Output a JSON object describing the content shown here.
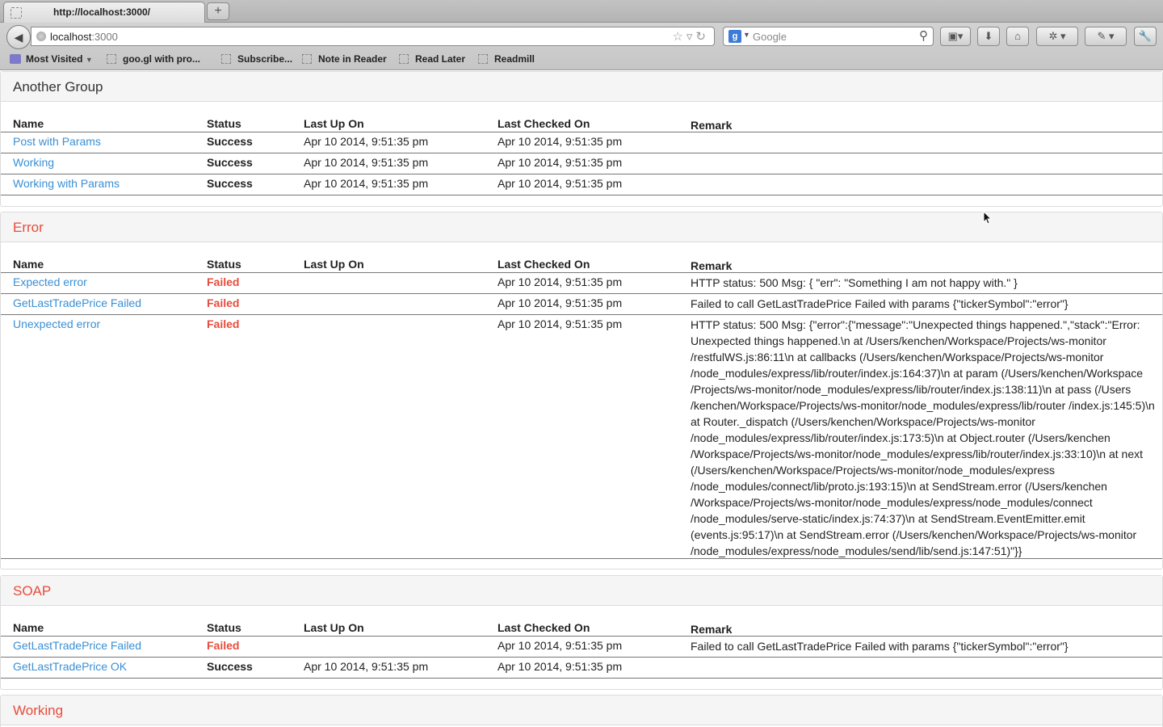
{
  "browser": {
    "tab_title": "http://localhost:3000/",
    "new_tab_label": "+",
    "url_host": "localhost",
    "url_port": ":3000",
    "search_placeholder": "Google",
    "bookmarks": [
      "Most Visited",
      "goo.gl with pro...",
      "Subscribe...",
      "Note in Reader",
      "Read Later",
      "Readmill"
    ]
  },
  "columns": {
    "name": "Name",
    "status": "Status",
    "last_up": "Last Up On",
    "last_checked": "Last Checked On",
    "remark": "Remark"
  },
  "groups": [
    {
      "title": "Another Group",
      "error": false,
      "rows": [
        {
          "name": "Post with Params",
          "status": "Success",
          "last_up": "Apr 10 2014, 9:51:35 pm",
          "last_checked": "Apr 10 2014, 9:51:35 pm",
          "remark": ""
        },
        {
          "name": "Working",
          "status": "Success",
          "last_up": "Apr 10 2014, 9:51:35 pm",
          "last_checked": "Apr 10 2014, 9:51:35 pm",
          "remark": ""
        },
        {
          "name": "Working with Params",
          "status": "Success",
          "last_up": "Apr 10 2014, 9:51:35 pm",
          "last_checked": "Apr 10 2014, 9:51:35 pm",
          "remark": ""
        }
      ]
    },
    {
      "title": "Error",
      "error": true,
      "rows": [
        {
          "name": "Expected error",
          "status": "Failed",
          "last_up": "",
          "last_checked": "Apr 10 2014, 9:51:35 pm",
          "remark": "HTTP status: 500 Msg: { \"err\": \"Something I am not happy with.\" }"
        },
        {
          "name": "GetLastTradePrice Failed",
          "status": "Failed",
          "last_up": "",
          "last_checked": "Apr 10 2014, 9:51:35 pm",
          "remark": "Failed to call GetLastTradePrice Failed with params {\"tickerSymbol\":\"error\"}"
        },
        {
          "name": "Unexpected error",
          "status": "Failed",
          "last_up": "",
          "last_checked": "Apr 10 2014, 9:51:35 pm",
          "remark": "HTTP status: 500 Msg: {\"error\":{\"message\":\"Unexpected things happened.\",\"stack\":\"Error: Unexpected things happened.\\n at /Users/kenchen/Workspace/Projects/ws-monitor /restfulWS.js:86:11\\n at callbacks (/Users/kenchen/Workspace/Projects/ws-monitor /node_modules/express/lib/router/index.js:164:37)\\n at param (/Users/kenchen/Workspace /Projects/ws-monitor/node_modules/express/lib/router/index.js:138:11)\\n at pass (/Users /kenchen/Workspace/Projects/ws-monitor/node_modules/express/lib/router /index.js:145:5)\\n at Router._dispatch (/Users/kenchen/Workspace/Projects/ws-monitor /node_modules/express/lib/router/index.js:173:5)\\n at Object.router (/Users/kenchen /Workspace/Projects/ws-monitor/node_modules/express/lib/router/index.js:33:10)\\n at next (/Users/kenchen/Workspace/Projects/ws-monitor/node_modules/express /node_modules/connect/lib/proto.js:193:15)\\n at SendStream.error (/Users/kenchen /Workspace/Projects/ws-monitor/node_modules/express/node_modules/connect /node_modules/serve-static/index.js:74:37)\\n at SendStream.EventEmitter.emit (events.js:95:17)\\n at SendStream.error (/Users/kenchen/Workspace/Projects/ws-monitor /node_modules/express/node_modules/send/lib/send.js:147:51)\"}}"
        }
      ]
    },
    {
      "title": "SOAP",
      "error": true,
      "rows": [
        {
          "name": "GetLastTradePrice Failed",
          "status": "Failed",
          "last_up": "",
          "last_checked": "Apr 10 2014, 9:51:35 pm",
          "remark": "Failed to call GetLastTradePrice Failed with params {\"tickerSymbol\":\"error\"}"
        },
        {
          "name": "GetLastTradePrice OK",
          "status": "Success",
          "last_up": "Apr 10 2014, 9:51:35 pm",
          "last_checked": "Apr 10 2014, 9:51:35 pm",
          "remark": ""
        }
      ]
    },
    {
      "title": "Working",
      "error": true,
      "rows": []
    }
  ],
  "colors": {
    "link": "#3a8fd4",
    "failed": "#e74c3c",
    "group_header_bg": "#f5f5f5"
  }
}
